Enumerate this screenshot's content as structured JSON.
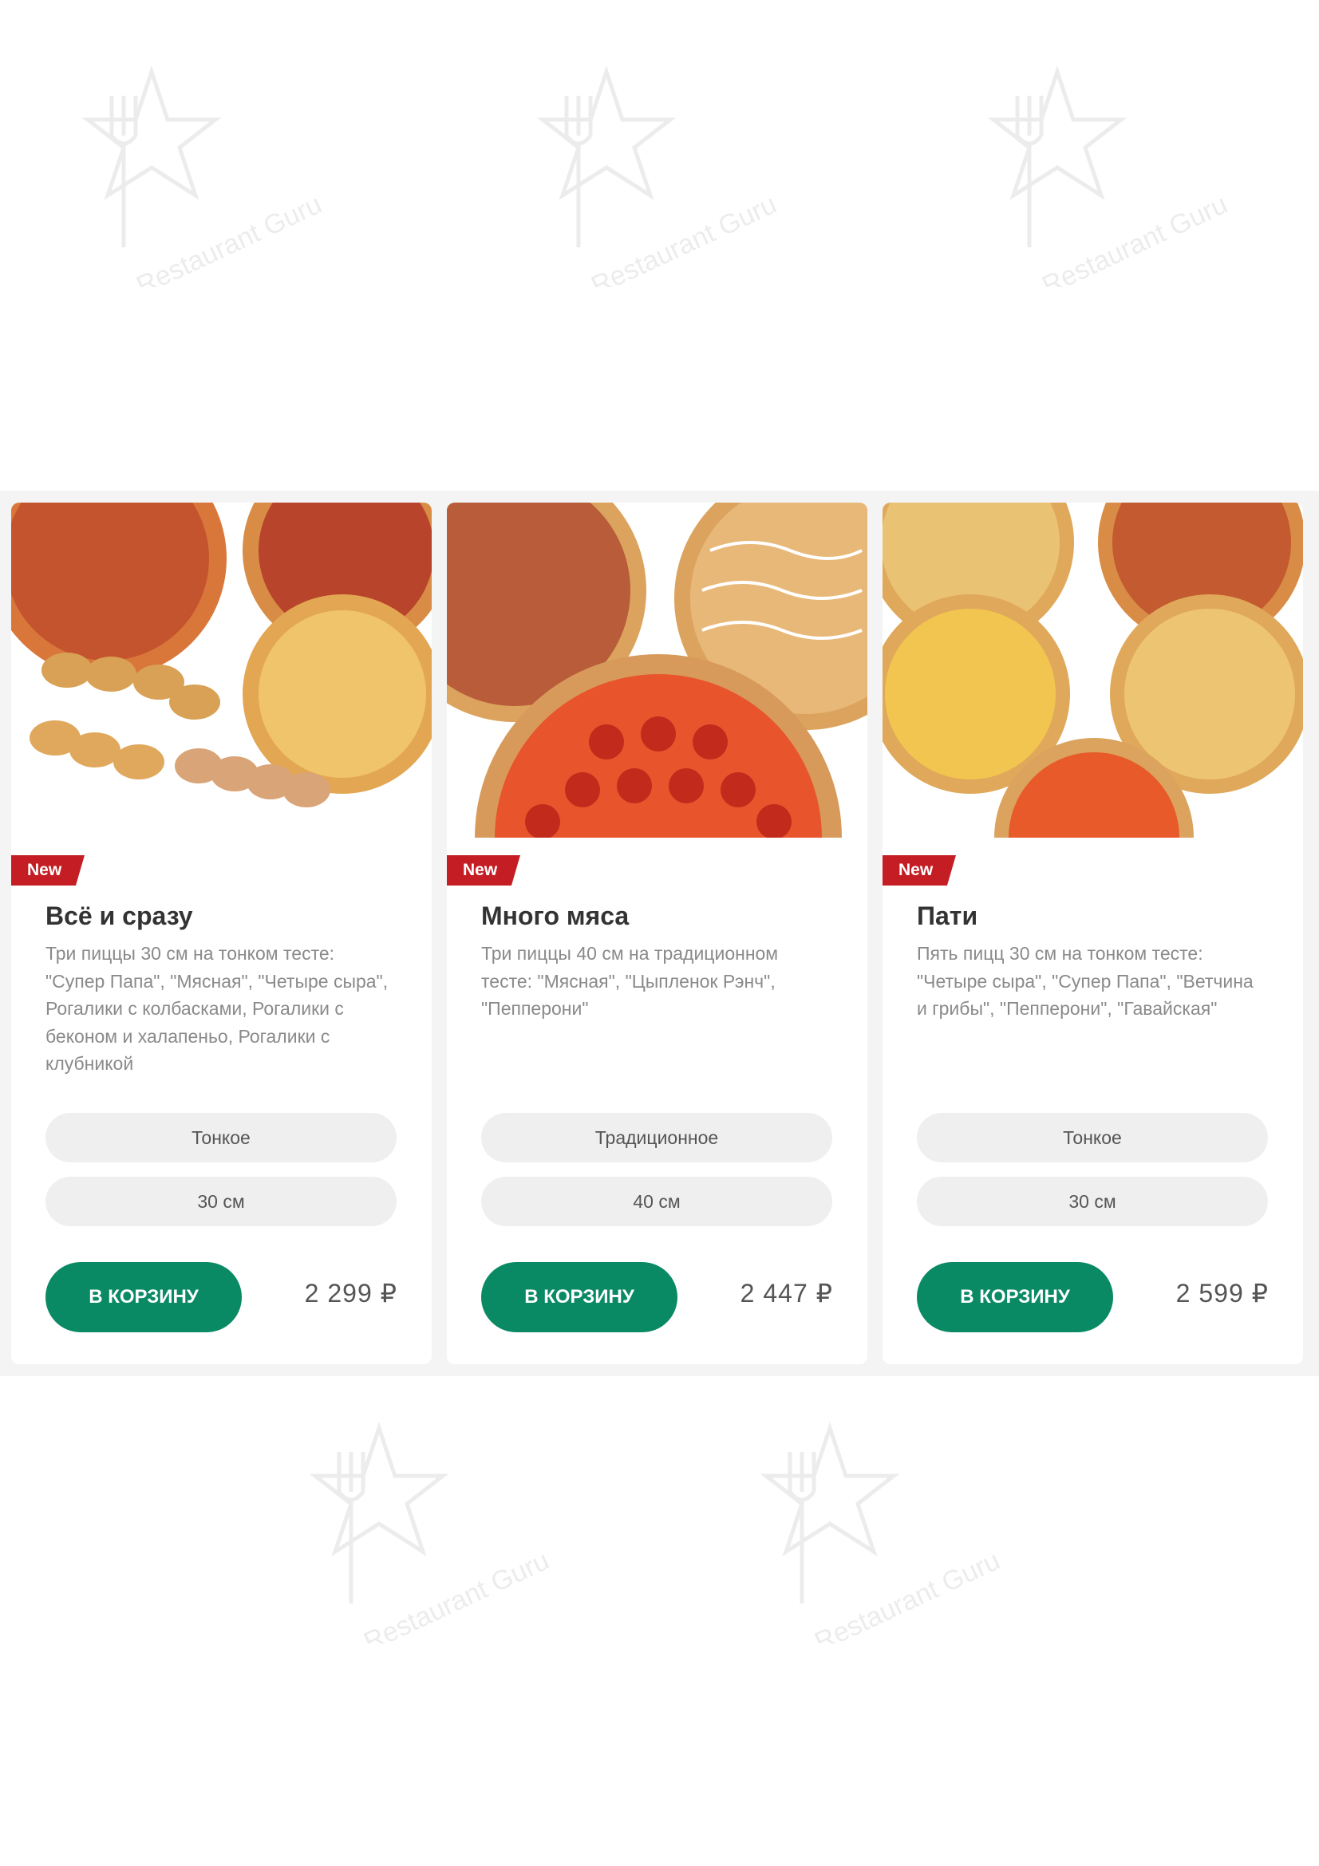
{
  "watermark": {
    "text": "Restaurant Guru"
  },
  "cards": [
    {
      "badge": "New",
      "title": "Всё и сразу",
      "description": "Три пиццы 30 см на тонком тесте: \"Супер Папа\", \"Мясная\", \"Четыре сыра\", Рогалики с колбасками, Рогалики с беконом и халапеньо, Рогалики с клубникой",
      "crust": "Тонкое",
      "size": "30 см",
      "button": "В КОРЗИНУ",
      "price": "2 299 ₽"
    },
    {
      "badge": "New",
      "title": "Много мяса",
      "description": "Три пиццы 40 см на традиционном тесте: \"Мясная\", \"Цыпленок Рэнч\", \"Пепперони\"",
      "crust": "Традиционное",
      "size": "40 см",
      "button": "В КОРЗИНУ",
      "price": "2 447 ₽"
    },
    {
      "badge": "New",
      "title": "Пати",
      "description": "Пять пицц 30 см на тонком тесте: \"Четыре сыра\", \"Супер Папа\", \"Ветчина и грибы\", \"Пепперони\", \"Гавайская\"",
      "crust": "Тонкое",
      "size": "30 см",
      "button": "В КОРЗИНУ",
      "price": "2 599 ₽"
    }
  ],
  "colors": {
    "button": "#0a8a64",
    "badge": "#c41e24",
    "option_bg": "#efefef"
  }
}
